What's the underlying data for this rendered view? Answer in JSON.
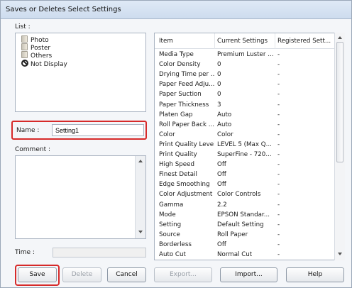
{
  "window": {
    "title": "Saves or Deletes Select Settings"
  },
  "list": {
    "label": "List :",
    "items": [
      {
        "label": "Photo",
        "icon": "folder-icon"
      },
      {
        "label": "Poster",
        "icon": "folder-icon"
      },
      {
        "label": "Others",
        "icon": "folder-icon"
      },
      {
        "label": "Not Display",
        "icon": "no-entry-icon"
      }
    ]
  },
  "name": {
    "label": "Name :",
    "value": "Setting1"
  },
  "comment": {
    "label": "Comment :",
    "value": ""
  },
  "time": {
    "label": "Time :",
    "value": ""
  },
  "table": {
    "columns": [
      "Item",
      "Current Settings",
      "Registered Sett..."
    ],
    "rows": [
      [
        "Media Type",
        "Premium Luster ...",
        "-"
      ],
      [
        "Color Density",
        "0",
        "-"
      ],
      [
        "Drying Time per ...",
        "0",
        "-"
      ],
      [
        "Paper Feed Adju...",
        "0",
        "-"
      ],
      [
        "Paper Suction",
        "0",
        "-"
      ],
      [
        "Paper Thickness",
        "3",
        "-"
      ],
      [
        "Platen Gap",
        "Auto",
        "-"
      ],
      [
        "Roll Paper Back ...",
        "Auto",
        "-"
      ],
      [
        "Color",
        "Color",
        "-"
      ],
      [
        "Print Quality Level",
        "LEVEL 5 (Max Q...",
        "-"
      ],
      [
        "Print Quality",
        "SuperFine - 720...",
        "-"
      ],
      [
        "High Speed",
        "Off",
        "-"
      ],
      [
        "Finest Detail",
        "Off",
        "-"
      ],
      [
        "Edge Smoothing",
        "Off",
        "-"
      ],
      [
        "Color Adjustment",
        "Color Controls",
        "-"
      ],
      [
        "Gamma",
        "2.2",
        "-"
      ],
      [
        "Mode",
        "EPSON Standar...",
        "-"
      ],
      [
        "Setting",
        "Default Setting",
        "-"
      ],
      [
        "Source",
        "Roll Paper",
        "-"
      ],
      [
        "Borderless",
        "Off",
        "-"
      ],
      [
        "Auto Cut",
        "Normal Cut",
        "-"
      ]
    ]
  },
  "buttons": {
    "save": "Save",
    "delete": "Delete",
    "cancel": "Cancel",
    "export": "Export...",
    "import": "Import...",
    "help": "Help"
  },
  "colors": {
    "highlight": "#d62a2a",
    "title_bar": "#cddcee"
  }
}
